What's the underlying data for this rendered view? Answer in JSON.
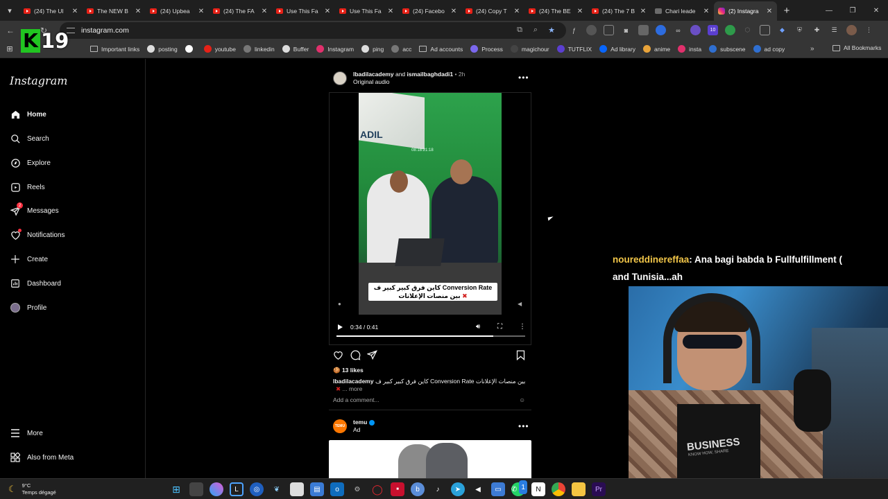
{
  "browser": {
    "tabs": [
      {
        "label": "(24) The Ul",
        "icon": "youtube-icon"
      },
      {
        "label": "The NEW B",
        "icon": "youtube-icon"
      },
      {
        "label": "(24) Upbea",
        "icon": "youtube-icon"
      },
      {
        "label": "(24) The FA",
        "icon": "youtube-icon"
      },
      {
        "label": "Use This Fa",
        "icon": "youtube-icon"
      },
      {
        "label": "Use This Fa",
        "icon": "youtube-icon"
      },
      {
        "label": "(24) Facebo",
        "icon": "youtube-icon"
      },
      {
        "label": "(24) Copy T",
        "icon": "youtube-icon"
      },
      {
        "label": "(24) The BE",
        "icon": "youtube-icon"
      },
      {
        "label": "(24) The 7 B",
        "icon": "youtube-icon"
      },
      {
        "label": "Chari leade",
        "icon": "blank-page-icon"
      },
      {
        "label": "(2) Instagra",
        "icon": "instagram-icon",
        "active": true
      }
    ],
    "url": "instagram.com",
    "bookmarks": [
      {
        "label": "Important links",
        "icon": "folder-icon"
      },
      {
        "label": "posting",
        "icon": "page-icon"
      },
      {
        "label": "",
        "icon": "google-icon"
      },
      {
        "label": "youtube",
        "icon": "youtube-icon"
      },
      {
        "label": "linkedin",
        "icon": "globe-icon"
      },
      {
        "label": "Buffer",
        "icon": "buffer-icon"
      },
      {
        "label": "Instagram",
        "icon": "instagram-icon"
      },
      {
        "label": "ping",
        "icon": "page-icon"
      },
      {
        "label": "acc",
        "icon": "globe-icon"
      },
      {
        "label": "Ad accounts",
        "icon": "folder-icon"
      },
      {
        "label": "Process",
        "icon": "process-icon"
      },
      {
        "label": "magichour",
        "icon": "magichour-icon"
      },
      {
        "label": "TUTFLIX",
        "icon": "tutflix-icon"
      },
      {
        "label": "Ad library",
        "icon": "meta-icon"
      },
      {
        "label": "anime",
        "icon": "anime-icon"
      },
      {
        "label": "insta",
        "icon": "instagram-icon"
      },
      {
        "label": "subscene",
        "icon": "subscene-icon"
      },
      {
        "label": "ad copy",
        "icon": "subscene-icon"
      }
    ],
    "all_bookmarks": "All Bookmarks",
    "extension_badge": "10"
  },
  "overlay_logo": {
    "letter": "K",
    "number": "19"
  },
  "sidebar": {
    "logo": "Instagram",
    "items": [
      {
        "label": "Home",
        "icon": "home-icon"
      },
      {
        "label": "Search",
        "icon": "search-icon"
      },
      {
        "label": "Explore",
        "icon": "compass-icon"
      },
      {
        "label": "Reels",
        "icon": "reels-icon"
      },
      {
        "label": "Messages",
        "icon": "messenger-icon",
        "badge": "2"
      },
      {
        "label": "Notifications",
        "icon": "heart-icon"
      },
      {
        "label": "Create",
        "icon": "plus-icon"
      },
      {
        "label": "Dashboard",
        "icon": "dashboard-icon"
      },
      {
        "label": "Profile",
        "icon": "profile-avatar-icon"
      }
    ],
    "more": "More",
    "also_from_meta": "Also from Meta"
  },
  "post": {
    "author": "lbadilacademy",
    "coauthor_joiner": "and",
    "coauthor": "ismailbaghdadi1",
    "age": "• 2h",
    "audio": "Original audio",
    "video": {
      "screen_text": "ADIL",
      "timestamp": "08:18:21:18",
      "caption_line1": "كاين فرق كبير كبير ف Conversion Rate",
      "caption_line2": "بين منصات الإعلانات",
      "time": "0:34 / 0:41",
      "progress": 0.83
    },
    "likes": "13 likes",
    "caption_user": "lbadilacademy",
    "caption_text": "كاين فرق كبير كبير ف Conversion Rate بين منصات الإعلانات",
    "caption_more": "... more",
    "comment_placeholder": "Add a comment..."
  },
  "post2": {
    "author": "temu",
    "sponsored": "Ad",
    "avatar_text": "TEMU"
  },
  "chat": {
    "username": "noureddinereffaa",
    "message": ": Ana bagi babda b Fullfulfillment (",
    "message_line2": "and Tunisia...ah"
  },
  "webcam": {
    "shirt_text": "BUSINESS",
    "shirt_sub": "KNOW HOW, SHARE"
  },
  "taskbar": {
    "temperature": "9°C",
    "weather": "Temps dégagé",
    "whatsapp_badge": "1"
  }
}
